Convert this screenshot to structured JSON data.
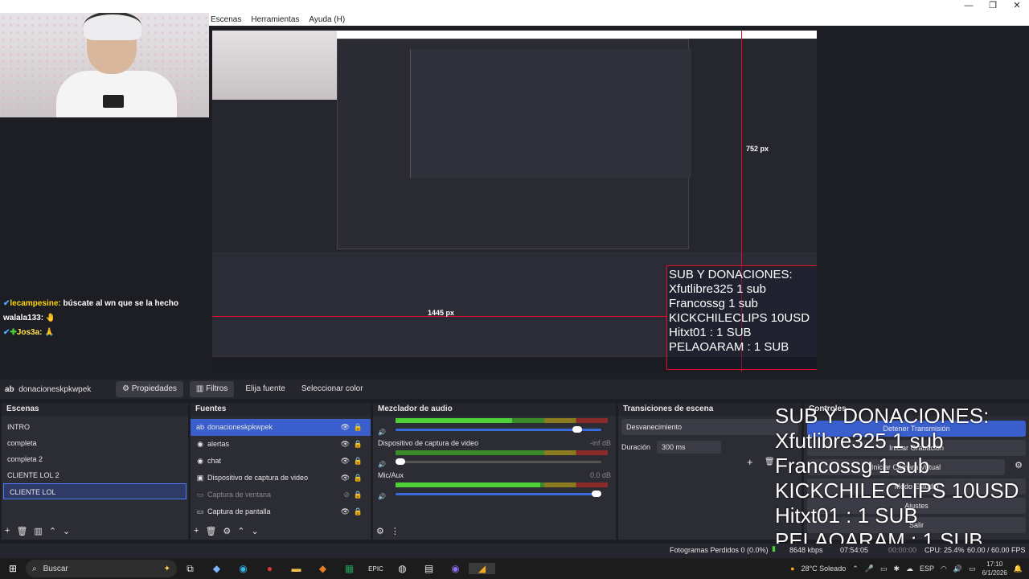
{
  "menu": {
    "scenes": "Escenas",
    "tools": "Herramientas",
    "help": "Ayuda (H)"
  },
  "window_controls": {
    "minimize": "—",
    "maximize": "❐",
    "close": "✕"
  },
  "chat": [
    {
      "name": "lecampesine:",
      "message": " búscate al wn que se la hecho"
    },
    {
      "name": "walala133:",
      "message": " 🤚"
    },
    {
      "name": "Jos3a:",
      "message": " 🙏"
    }
  ],
  "preview": {
    "height_label": "752 px",
    "width_label": "1445 px",
    "overlay_lines": [
      "SUB Y DONACIONES:",
      "Xfutlibre325 1 sub",
      "Francossg 1 sub",
      "KICKCHILECLIPS 10USD",
      "Hitxt01 : 1 SUB",
      "PELAOARAM : 1 SUB"
    ]
  },
  "source_toolbar": {
    "name": "donacioneskpkwpek",
    "properties": "Propiedades",
    "filters": "Filtros",
    "choose": "Elija fuente",
    "color": "Seleccionar color"
  },
  "scenes": {
    "title": "Escenas",
    "items": [
      "INTRO",
      "completa",
      "completa 2",
      "CLIENTE LOL 2",
      "CLIENTE LOL"
    ]
  },
  "sources": {
    "title": "Fuentes",
    "items": [
      {
        "icon": "ab",
        "label": "donacioneskpkwpek"
      },
      {
        "icon": "◉",
        "label": "alertas"
      },
      {
        "icon": "◉",
        "label": "chat"
      },
      {
        "icon": "▣",
        "label": "Dispositivo de captura de video"
      },
      {
        "icon": "▭",
        "label": "Captura de ventana"
      },
      {
        "icon": "▭",
        "label": "Captura de pantalla"
      }
    ]
  },
  "mixer": {
    "title": "Mezclador de audio",
    "channels": [
      {
        "label": "",
        "db": "",
        "level": 0.55,
        "volume": 0.9
      },
      {
        "label": "Dispositivo de captura de video",
        "db": "-inf dB",
        "level": 0,
        "volume": 0.0
      },
      {
        "label": "Mic/Aux",
        "db": "0.0 dB",
        "level": 0.68,
        "volume": 1.0
      }
    ]
  },
  "transitions": {
    "title": "Transiciones de escena",
    "type": "Desvanecimiento",
    "duration_label": "Duración",
    "duration": "300 ms"
  },
  "controls": {
    "title": "Controles",
    "stop_stream": "Detener Transmisión",
    "start_record": "Iniciar Grabación",
    "virtual_cam": "Iniciar Cámara Virtual",
    "studio": "Modo Estudio",
    "settings": "Ajustes",
    "exit": "Salir"
  },
  "overlay_lines": [
    "SUB Y DONACIONES:",
    "Xfutlibre325 1 sub",
    "Francossg 1 sub",
    "KICKCHILECLIPS 10USD",
    "Hitxt01 : 1 SUB",
    "PELAOARAM : 1 SUB"
  ],
  "status": {
    "dropped": "Fotogramas Perdidos 0 (0.0%)",
    "kbps": "8648 kbps",
    "time": "07:54:05",
    "rec": "00:00:00",
    "cpu": "CPU: 25.4%",
    "fps": "60.00 / 60.00 FPS"
  },
  "taskbar": {
    "search": "Buscar",
    "weather": "28°C  Soleado",
    "lang": "ESP",
    "time": "17:10",
    "date": "6/1/2026"
  }
}
